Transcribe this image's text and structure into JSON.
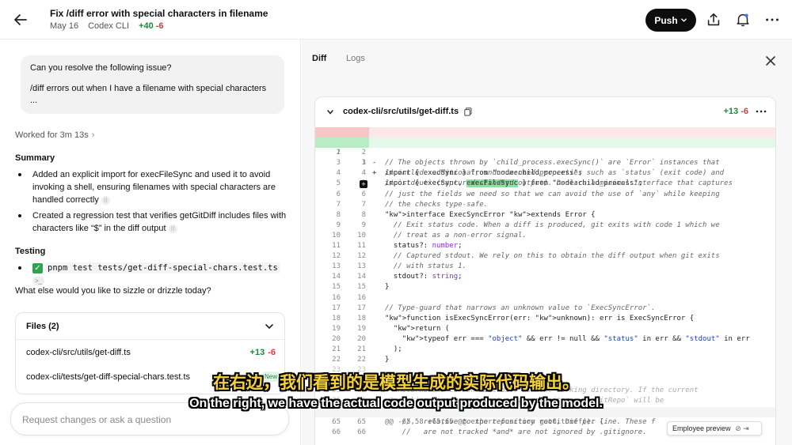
{
  "header": {
    "title": "Fix /diff error with special characters in filename",
    "date": "May 16",
    "source": "Codex CLI",
    "additions": "+40",
    "deletions": "-6",
    "push_label": "Push"
  },
  "chat": {
    "user_message_line1": "Can you resolve the following issue?",
    "user_message_line2": "/diff errors out when I have a filename with special characters",
    "user_message_line3": "...",
    "worked_for": "Worked for 3m 13s",
    "summary_heading": "Summary",
    "summary_items": [
      "Added an explicit import for execFileSync and used it to avoid invoking a shell, ensuring filenames with special characters are handled correctly",
      "Created a regression test that verifies getGitDiff includes files with characters like “$” in the diff output"
    ],
    "testing_heading": "Testing",
    "testing_command": "pnpm test tests/get-diff-special-chars.test.ts",
    "question": "What else would you like to sizzle or drizzle today?"
  },
  "files": {
    "heading": "Files (2)",
    "items": [
      {
        "path": "codex-cli/src/utils/get-diff.ts",
        "add": "+13",
        "del": "-6"
      },
      {
        "path": "codex-cli/tests/get-diff-special-chars.test.ts",
        "badge": "New"
      }
    ]
  },
  "composer": {
    "placeholder": "Request changes or ask a question"
  },
  "panel": {
    "tabs": [
      "Diff",
      "Logs"
    ],
    "file_path": "codex-cli/src/utils/get-diff.ts",
    "additions": "+13",
    "deletions": "-6"
  },
  "code": {
    "del_line": {
      "n1": "1",
      "text": "import { execSync } from \"node:child_process\";"
    },
    "add_line": {
      "n2": "1",
      "pre": "import { execSync, ",
      "hl": "execFileSync",
      "post": " } from \"node:child_process\";"
    },
    "lines": [
      {
        "n1": "2",
        "n2": "2",
        "text": "",
        "cls": ""
      },
      {
        "n1": "3",
        "n2": "3",
        "text": "// The objects thrown by `child_process.execSync()` are `Error` instances that",
        "cls": "cmt"
      },
      {
        "n1": "4",
        "n2": "4",
        "text": "// include additional, undocumented properties such as `status` (exit code) and",
        "cls": "cmt"
      },
      {
        "n1": "5",
        "n2": "5",
        "text": "// `stdout` (captured standard output). Declare a minimal interface that captures",
        "cls": "cmt"
      },
      {
        "n1": "6",
        "n2": "6",
        "text": "// just the fields we need so that we can avoid the use of `any` while keeping",
        "cls": "cmt"
      },
      {
        "n1": "7",
        "n2": "7",
        "text": "// the checks type-safe.",
        "cls": "cmt"
      },
      {
        "n1": "8",
        "n2": "8",
        "text": "interface ExecSyncError extends Error {",
        "cls": "kwl"
      },
      {
        "n1": "9",
        "n2": "9",
        "text": "  // Exit status code. When a diff is produced, git exits with code 1 which we",
        "cls": "cmt"
      },
      {
        "n1": "10",
        "n2": "10",
        "text": "  // treat as a non-error signal.",
        "cls": "cmt"
      },
      {
        "n1": "11",
        "n2": "11",
        "text": "  status?: number;",
        "cls": ""
      },
      {
        "n1": "12",
        "n2": "12",
        "text": "  // Captured stdout. We rely on this to obtain the diff output when git exits",
        "cls": "cmt"
      },
      {
        "n1": "13",
        "n2": "13",
        "text": "  // with status 1.",
        "cls": "cmt"
      },
      {
        "n1": "14",
        "n2": "14",
        "text": "  stdout?: string;",
        "cls": ""
      },
      {
        "n1": "15",
        "n2": "15",
        "text": "}",
        "cls": ""
      },
      {
        "n1": "16",
        "n2": "16",
        "text": "",
        "cls": ""
      },
      {
        "n1": "17",
        "n2": "17",
        "text": "// Type-guard that narrows an unknown value to `ExecSyncError`.",
        "cls": "cmt"
      },
      {
        "n1": "18",
        "n2": "18",
        "text": "function isExecSyncError(err: unknown): err is ExecSyncError {",
        "cls": ""
      },
      {
        "n1": "19",
        "n2": "19",
        "text": "  return (",
        "cls": ""
      },
      {
        "n1": "20",
        "n2": "20",
        "text": "    typeof err === \"object\" && err != null && \"status\" in err && \"stdout\" in err",
        "cls": ""
      },
      {
        "n1": "21",
        "n2": "21",
        "text": "  );",
        "cls": ""
      },
      {
        "n1": "22",
        "n2": "22",
        "text": "}",
        "cls": ""
      },
      {
        "n1": "23",
        "n2": "23",
        "text": "",
        "cls": "faded"
      },
      {
        "n1": "24",
        "n2": "24",
        "text": "/**",
        "cls": "cmt faded"
      },
      {
        "n1": "25",
        "n2": "25",
        "text": " * Returns the current Git diff for the working directory. If the current",
        "cls": "cmt faded"
      },
      {
        "n1": "26",
        "n2": "26",
        "text": " * working directory is not a Git repository, `isGitRepo` will be",
        "cls": "cmt faded"
      }
    ],
    "hunk": "@@ -65,58 +65,65 @@ export function getGitDiff(): {",
    "tail_lines": [
      {
        "n1": "65",
        "n2": "65",
        "text": "    //   relative to the repository root, one per line. These f",
        "cls": "cmt"
      },
      {
        "n1": "66",
        "n2": "66",
        "text": "    //   are not tracked *and* are not ignored by .gitignore.",
        "cls": "cmt"
      }
    ]
  },
  "badge": {
    "employee_preview": "Employee preview"
  },
  "subtitles": {
    "cn": "在右边，我们看到的是模型生成的实际代码输出。",
    "en": "On the right, we have the actual code output produced by the model."
  }
}
